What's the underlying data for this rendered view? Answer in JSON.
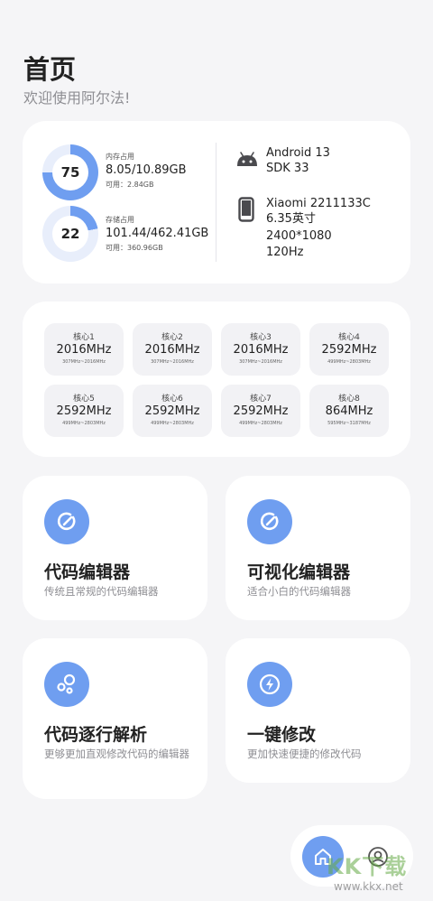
{
  "header": {
    "title": "首页",
    "subtitle": "欢迎使用阿尔法!"
  },
  "memory": {
    "percent": "75",
    "percent_value": 75,
    "label": "内存占用",
    "value": "8.05/10.89GB",
    "available": "可用：2.84GB"
  },
  "storage": {
    "percent": "22",
    "percent_value": 22,
    "label": "存储占用",
    "value": "101.44/462.41GB",
    "available": "可用：360.96GB"
  },
  "system": {
    "android": "Android 13",
    "sdk": "SDK 33",
    "device": "Xiaomi 2211133C",
    "screen_size": "6.35英寸",
    "resolution": "2400*1080",
    "refresh": "120Hz"
  },
  "cores": [
    {
      "name": "核心1",
      "freq": "2016MHz",
      "range": "307MHz~2016MHz"
    },
    {
      "name": "核心2",
      "freq": "2016MHz",
      "range": "307MHz~2016MHz"
    },
    {
      "name": "核心3",
      "freq": "2016MHz",
      "range": "307MHz~2016MHz"
    },
    {
      "name": "核心4",
      "freq": "2592MHz",
      "range": "499MHz~2803MHz"
    },
    {
      "name": "核心5",
      "freq": "2592MHz",
      "range": "499MHz~2803MHz"
    },
    {
      "name": "核心6",
      "freq": "2592MHz",
      "range": "499MHz~2803MHz"
    },
    {
      "name": "核心7",
      "freq": "2592MHz",
      "range": "499MHz~2803MHz"
    },
    {
      "name": "核心8",
      "freq": "864MHz",
      "range": "595MHz~3187MHz"
    }
  ],
  "tools": [
    {
      "title": "代码编辑器",
      "desc": "传统且常规的代码编辑器",
      "icon": "edit-icon"
    },
    {
      "title": "可视化编辑器",
      "desc": "适合小白的代码编辑器",
      "icon": "edit-icon"
    },
    {
      "title": "代码逐行解析",
      "desc": "更够更加直观修改代码的编辑器",
      "icon": "bubbles-icon"
    },
    {
      "title": "一键修改",
      "desc": "更加快速便捷的修改代码",
      "icon": "lightning-icon"
    }
  ],
  "nav": {
    "home_icon": "home-icon",
    "user_icon": "user-icon"
  },
  "watermark": {
    "text": "KK下载",
    "url": "www.kkx.net"
  },
  "colors": {
    "accent": "#6f9ef0",
    "ring_track": "#e8eefb",
    "background": "#f5f5f7"
  }
}
